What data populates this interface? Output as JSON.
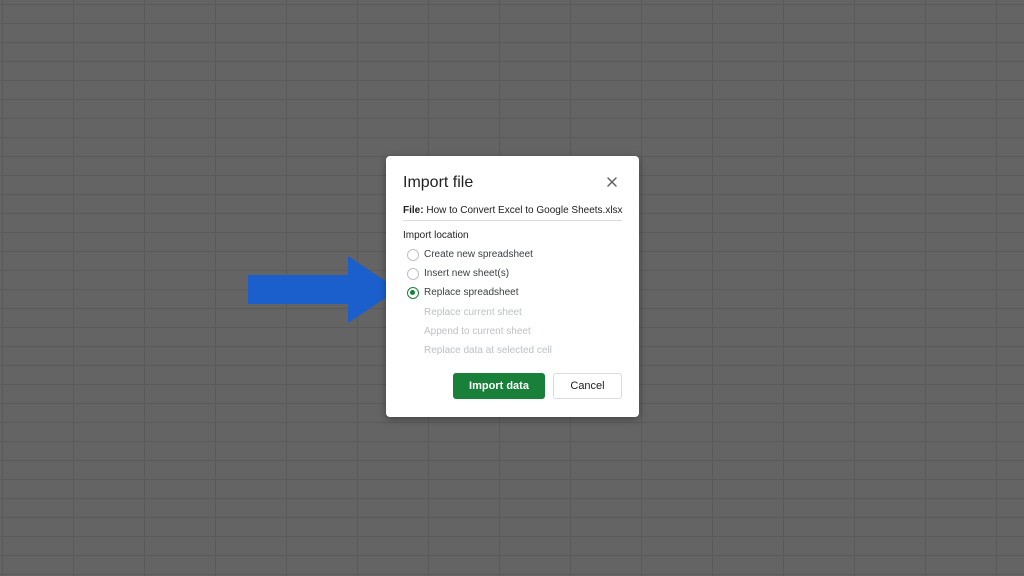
{
  "dialog": {
    "title": "Import file",
    "close_icon": "close-icon",
    "file_label": "File:",
    "file_name": "How to Convert Excel to Google Sheets.xlsx",
    "section_label": "Import location",
    "options": [
      {
        "label": "Create new spreadsheet",
        "checked": false
      },
      {
        "label": "Insert new sheet(s)",
        "checked": false
      },
      {
        "label": "Replace spreadsheet",
        "checked": true
      }
    ],
    "sub_options": [
      "Replace current sheet",
      "Append to current sheet",
      "Replace data at selected cell"
    ],
    "primary_button": "Import data",
    "secondary_button": "Cancel"
  },
  "colors": {
    "accent": "#188038",
    "arrow": "#1a5fcc",
    "backdrop": "#646464"
  },
  "annotation": {
    "icon": "arrow-right-icon"
  }
}
